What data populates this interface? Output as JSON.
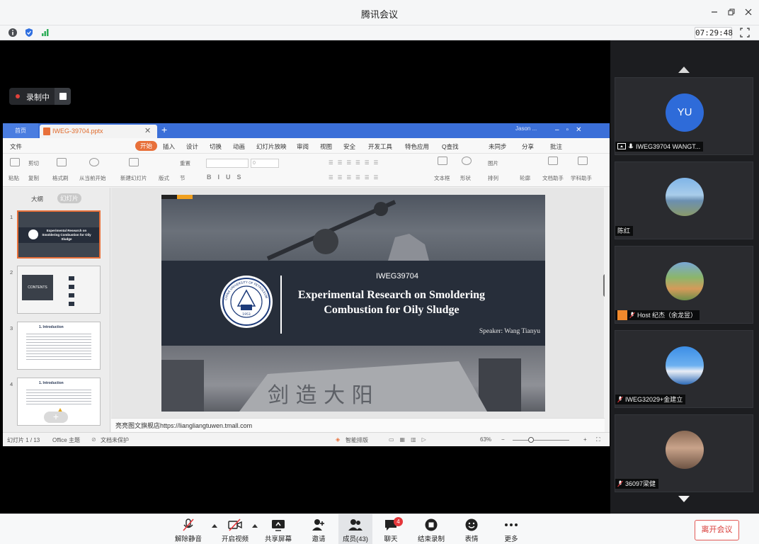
{
  "window": {
    "title": "腾讯会议",
    "clock": "07:29:48"
  },
  "recording": {
    "label": "录制中"
  },
  "wps": {
    "home_tab": "首页",
    "doc_tab": "IWEG-39704.pptx",
    "user": "Jason ...",
    "menu": [
      "文件",
      "开始",
      "插入",
      "设计",
      "切换",
      "动画",
      "幻灯片放映",
      "审阅",
      "视图",
      "安全",
      "开发工具",
      "特色应用",
      "Q查找",
      "未同步",
      "分享",
      "批注"
    ],
    "ribbon": [
      "粘贴",
      "剪切",
      "复制",
      "格式刷",
      "从当前开始",
      "新建幻灯片",
      "版式",
      "重置",
      "节",
      "0",
      "文本框",
      "形状",
      "图片",
      "排列",
      "轮廓",
      "文档助手",
      "学科助手"
    ],
    "left_tabs": [
      "大纲",
      "幻灯片"
    ],
    "slide_numbers": [
      "1",
      "2",
      "3",
      "4"
    ],
    "thumb_texts": {
      "t1": "Experimental Research on Smoldering Combustion for Oily Sludge",
      "t2": "CONTENTS",
      "t3": "1. Introduction",
      "t4": "1. Introduction"
    },
    "slide": {
      "code": "IWEG39704",
      "title": "Experimental Research on Smoldering Combustion for Oily Sludge",
      "speaker": "Speaker: Wang Tianyu",
      "emblem_text": "CHINA UNIVERSITY OF PETROLEUM",
      "emblem_year": "1953"
    },
    "notes": "亮亮图文旗舰店https://liangliangtuwen.tmall.com",
    "status": {
      "slide": "幻灯片 1 / 13",
      "theme": "Office 主题",
      "protect": "文档未保护",
      "smart": "智能排版",
      "zoom": "63%"
    }
  },
  "participants": [
    {
      "avatar": "YU",
      "name": "IWEG39704 WANGT...",
      "sharing": true
    },
    {
      "name": "陈红"
    },
    {
      "name": "Host 纪杰（余龙昱）",
      "host": true
    },
    {
      "name": "IWEG32029+金建立"
    },
    {
      "name": "36097梁健"
    }
  ],
  "toolbar": {
    "mute": "解除静音",
    "video": "开启视频",
    "share": "共享屏幕",
    "invite": "邀请",
    "members": "成员(43)",
    "chat": "聊天",
    "chat_badge": "4",
    "record": "结束录制",
    "reaction": "表情",
    "more": "更多",
    "leave": "离开会议"
  },
  "colors": {
    "wps_blue": "#3b6fd8",
    "wps_orange": "#e8703a",
    "leave_red": "#d83b37",
    "avatar_blue": "#2e6bd9"
  }
}
